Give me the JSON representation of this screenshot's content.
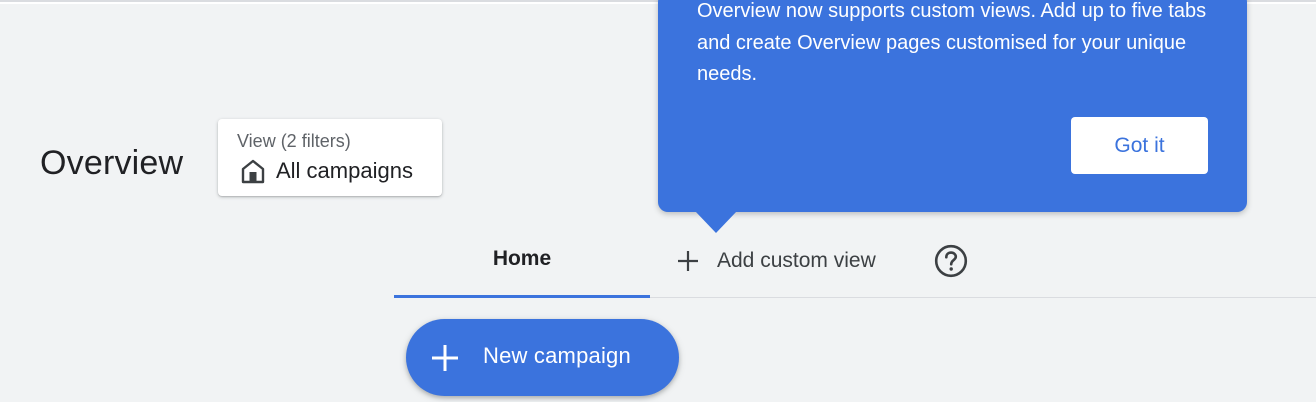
{
  "header": {
    "title": "Overview"
  },
  "view_selector": {
    "filters_label": "View (2 filters)",
    "selected_view": "All campaigns",
    "icon": "home-icon"
  },
  "tabs": [
    {
      "label": "Home",
      "active": true
    },
    {
      "label": "Add custom view",
      "icon": "plus-icon"
    }
  ],
  "help": {
    "icon": "help-circle-icon"
  },
  "tooltip": {
    "message": "Overview now supports custom views. Add up to five tabs and create Overview pages customised for your unique needs.",
    "dismiss_label": "Got it"
  },
  "fab": {
    "label": "New campaign",
    "icon": "plus-icon"
  },
  "colors": {
    "accent": "#3b73dd",
    "background": "#f1f3f4",
    "text": "#202124"
  }
}
